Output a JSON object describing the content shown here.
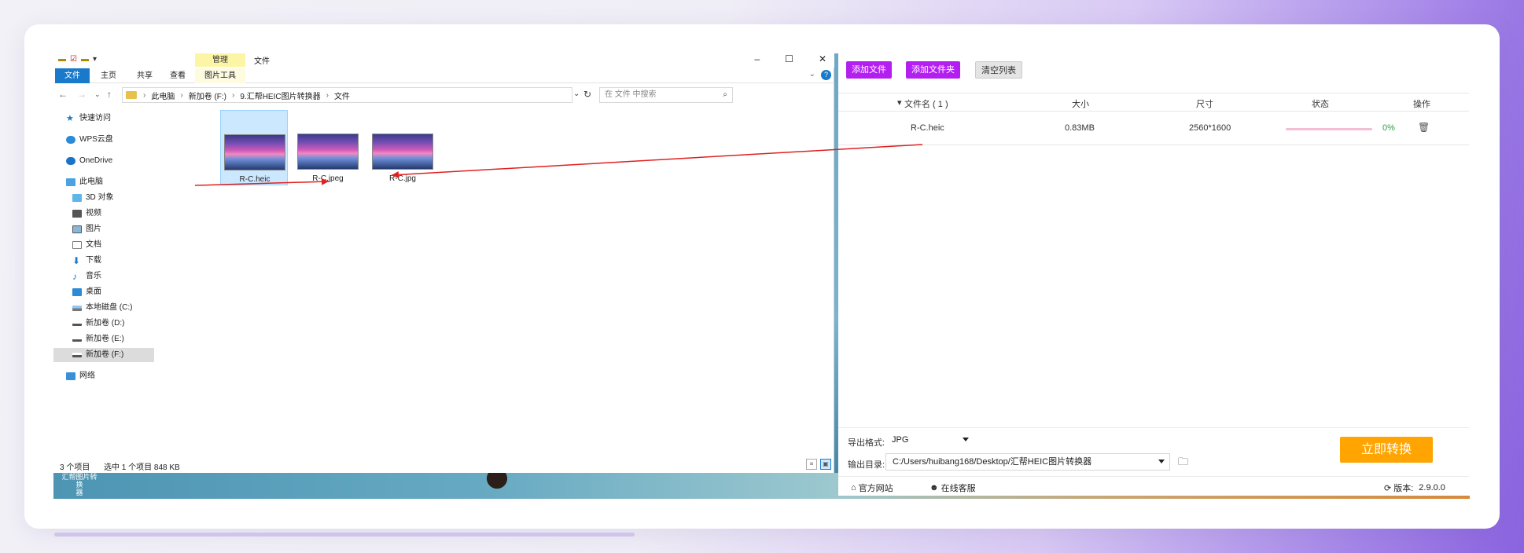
{
  "explorer": {
    "title": "文件",
    "manage_tab": "管理",
    "ribbon_tabs": [
      "文件",
      "主页",
      "共享",
      "查看",
      "图片工具"
    ],
    "address": [
      "此电脑",
      "新加卷 (F:)",
      "9.汇帮HEIC图片转换器",
      "文件"
    ],
    "search_placeholder": "在 文件 中搜索",
    "nav": [
      {
        "label": "快速访问",
        "icon": "star-icon"
      },
      {
        "label": "WPS云盘",
        "icon": "cloud-icon"
      },
      {
        "label": "OneDrive",
        "icon": "onedrive-icon"
      },
      {
        "label": "此电脑",
        "icon": "computer-icon"
      },
      {
        "label": "3D 对象",
        "icon": "cube-icon"
      },
      {
        "label": "视频",
        "icon": "video-icon"
      },
      {
        "label": "图片",
        "icon": "picture-icon"
      },
      {
        "label": "文档",
        "icon": "document-icon"
      },
      {
        "label": "下载",
        "icon": "download-icon"
      },
      {
        "label": "音乐",
        "icon": "music-icon"
      },
      {
        "label": "桌面",
        "icon": "desktop-icon"
      },
      {
        "label": "本地磁盘 (C:)",
        "icon": "drive-icon"
      },
      {
        "label": "新加卷 (D:)",
        "icon": "drive-icon"
      },
      {
        "label": "新加卷 (E:)",
        "icon": "drive-icon"
      },
      {
        "label": "新加卷 (F:)",
        "icon": "drive-icon"
      },
      {
        "label": "网络",
        "icon": "network-icon"
      }
    ],
    "files": [
      "R-C.heic",
      "R-C.jpeg",
      "R-C.jpg"
    ],
    "status_count": "3 个项目",
    "status_selected": "选中 1 个项目  848 KB"
  },
  "desktop": {
    "icon_label_1": "汇帮图片转换",
    "icon_label_2": "器"
  },
  "converter": {
    "btn_add_file": "添加文件",
    "btn_add_folder": "添加文件夹",
    "btn_clear": "清空列表",
    "headers": {
      "filename": "文件名 ( 1 )",
      "size": "大小",
      "dimensions": "尺寸",
      "status": "状态",
      "action": "操作"
    },
    "rows": [
      {
        "filename": "R-C.heic",
        "size": "0.83MB",
        "dimensions": "2560*1600",
        "progress": "0%"
      }
    ],
    "export_format_label": "导出格式:",
    "export_format_value": "JPG",
    "output_dir_label": "输出目录:",
    "output_dir_value": "C:/Users/huibang168/Desktop/汇帮HEIC图片转换器",
    "convert_btn": "立即转换",
    "footer": {
      "website": "官方网站",
      "support": "在线客服",
      "version_label": "版本:",
      "version_value": "2.9.0.0"
    }
  },
  "colors": {
    "purple_button": "#b31ff0",
    "convert_button": "#ffa400",
    "explorer_accent": "#1979ca",
    "progress_text": "#2ea043"
  }
}
